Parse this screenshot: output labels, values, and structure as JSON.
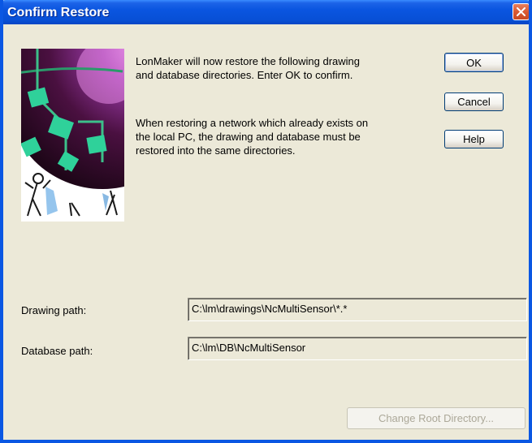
{
  "window": {
    "title": "Confirm Restore",
    "close_icon": "close-icon"
  },
  "message": {
    "line1": "LonMaker will now restore the following drawing\nand database directories.  Enter OK to confirm.",
    "line2": "When restoring a network which already exists on\nthe local PC, the drawing and database must be\nrestored into the same directories."
  },
  "buttons": {
    "ok": "OK",
    "cancel": "Cancel",
    "help": "Help",
    "change_root": "Change Root Directory..."
  },
  "fields": {
    "drawing_label": "Drawing path:",
    "drawing_value": "C:\\lm\\drawings\\NcMultiSensor\\*.*",
    "database_label": "Database path:",
    "database_value": "C:\\lm\\DB\\NcMultiSensor"
  },
  "colors": {
    "titlebar": "#0a55e0",
    "dialog_bg": "#ece9d8",
    "close_button": "#d95a33",
    "disabled_text": "#aca899"
  }
}
